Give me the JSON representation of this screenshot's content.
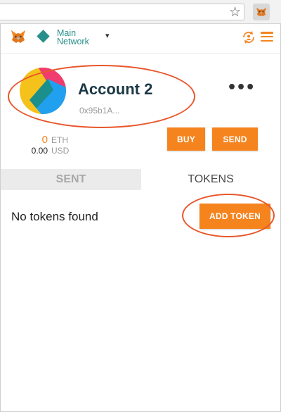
{
  "browser": {
    "star_icon": "star-icon",
    "extension_icon": "metamask-fox-icon"
  },
  "header": {
    "logo_icon": "metamask-fox-icon",
    "network_line1": "Main",
    "network_line2": "Network",
    "network_caret": "▾",
    "accounts_icon": "accounts-switch-icon",
    "menu_icon": "hamburger-menu-icon"
  },
  "account": {
    "name": "Account 2",
    "address": "0x95b1A...",
    "more_label": "•••"
  },
  "balance": {
    "eth_value": "0",
    "eth_unit": "ETH",
    "fiat_value": "0.00",
    "fiat_unit": "USD"
  },
  "actions": {
    "buy_label": "BUY",
    "send_label": "SEND"
  },
  "tabs": [
    {
      "label": "SENT",
      "active": false
    },
    {
      "label": "TOKENS",
      "active": true
    }
  ],
  "tokens": {
    "empty_text": "No tokens found",
    "add_token_label": "ADD TOKEN"
  },
  "colors": {
    "accent": "#f5841f",
    "network": "#27908a",
    "annotation": "#e8562a"
  }
}
